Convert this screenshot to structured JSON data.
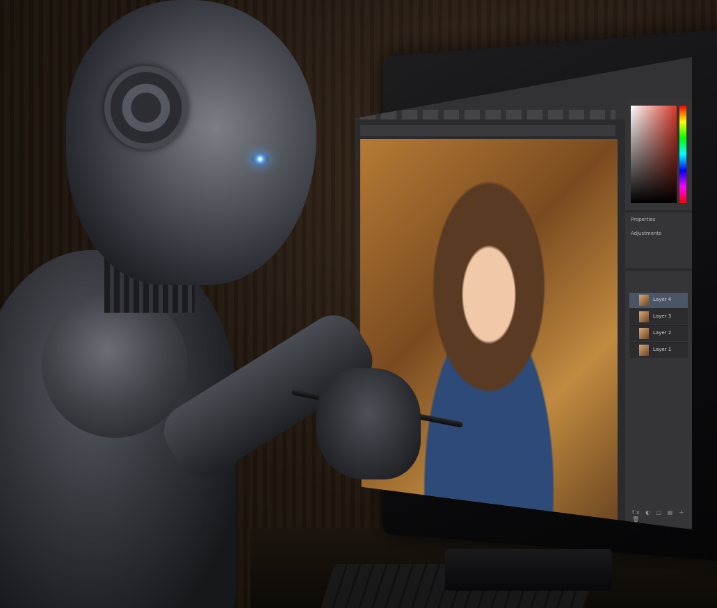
{
  "scene": {
    "description_icon": "robot-painting-icon",
    "accent_eye_color": "#4fa6ff"
  },
  "editor": {
    "panels": {
      "properties_label": "Properties",
      "adjustments_label": "Adjustments"
    },
    "layers": [
      {
        "name": "Layer 4",
        "selected": true
      },
      {
        "name": "Layer 3",
        "selected": false
      },
      {
        "name": "Layer 2",
        "selected": false
      },
      {
        "name": "Layer 1",
        "selected": false
      }
    ],
    "footer_icons": "fx ◐ ▢ ▤ ＋ 🗑"
  }
}
